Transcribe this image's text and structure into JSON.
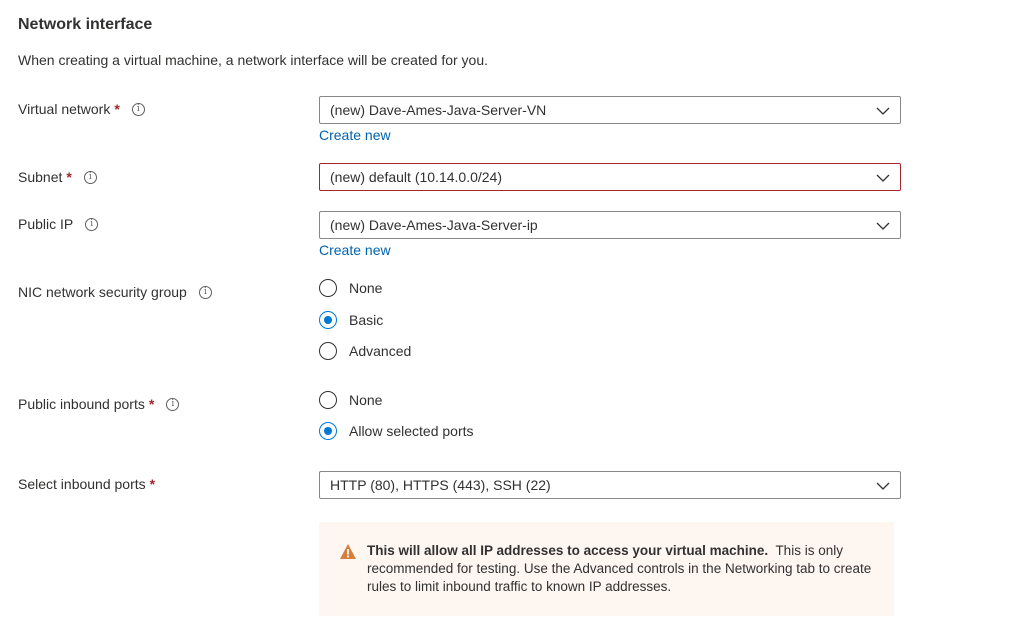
{
  "section": {
    "title": "Network interface",
    "description": "When creating a virtual machine, a network interface will be created for you."
  },
  "fields": {
    "virtual_network": {
      "label": "Virtual network",
      "value": "(new) Dave-Ames-Java-Server-VN",
      "create_new": "Create new"
    },
    "subnet": {
      "label": "Subnet",
      "value": "(new) default (10.14.0.0/24)"
    },
    "public_ip": {
      "label": "Public IP",
      "value": "(new) Dave-Ames-Java-Server-ip",
      "create_new": "Create new"
    },
    "nic_nsg": {
      "label": "NIC network security group",
      "options": [
        "None",
        "Basic",
        "Advanced"
      ],
      "selected": "Basic"
    },
    "public_inbound_ports": {
      "label": "Public inbound ports",
      "options": [
        "None",
        "Allow selected ports"
      ],
      "selected": "Allow selected ports"
    },
    "select_inbound_ports": {
      "label": "Select inbound ports",
      "value": "HTTP (80), HTTPS (443), SSH (22)"
    }
  },
  "required_mark": "*",
  "info_glyph": "i",
  "warning": {
    "bold": "This will allow all IP addresses to access your virtual machine.",
    "text": "This is only recommended for testing.  Use the Advanced controls in the Networking tab to create rules to limit inbound traffic to known IP addresses."
  },
  "colors": {
    "link": "#0062ad",
    "accent": "#0078d4",
    "required": "#a4262c",
    "warning_bg": "#fdf6f1",
    "warning_icon": "#d67f3c"
  }
}
